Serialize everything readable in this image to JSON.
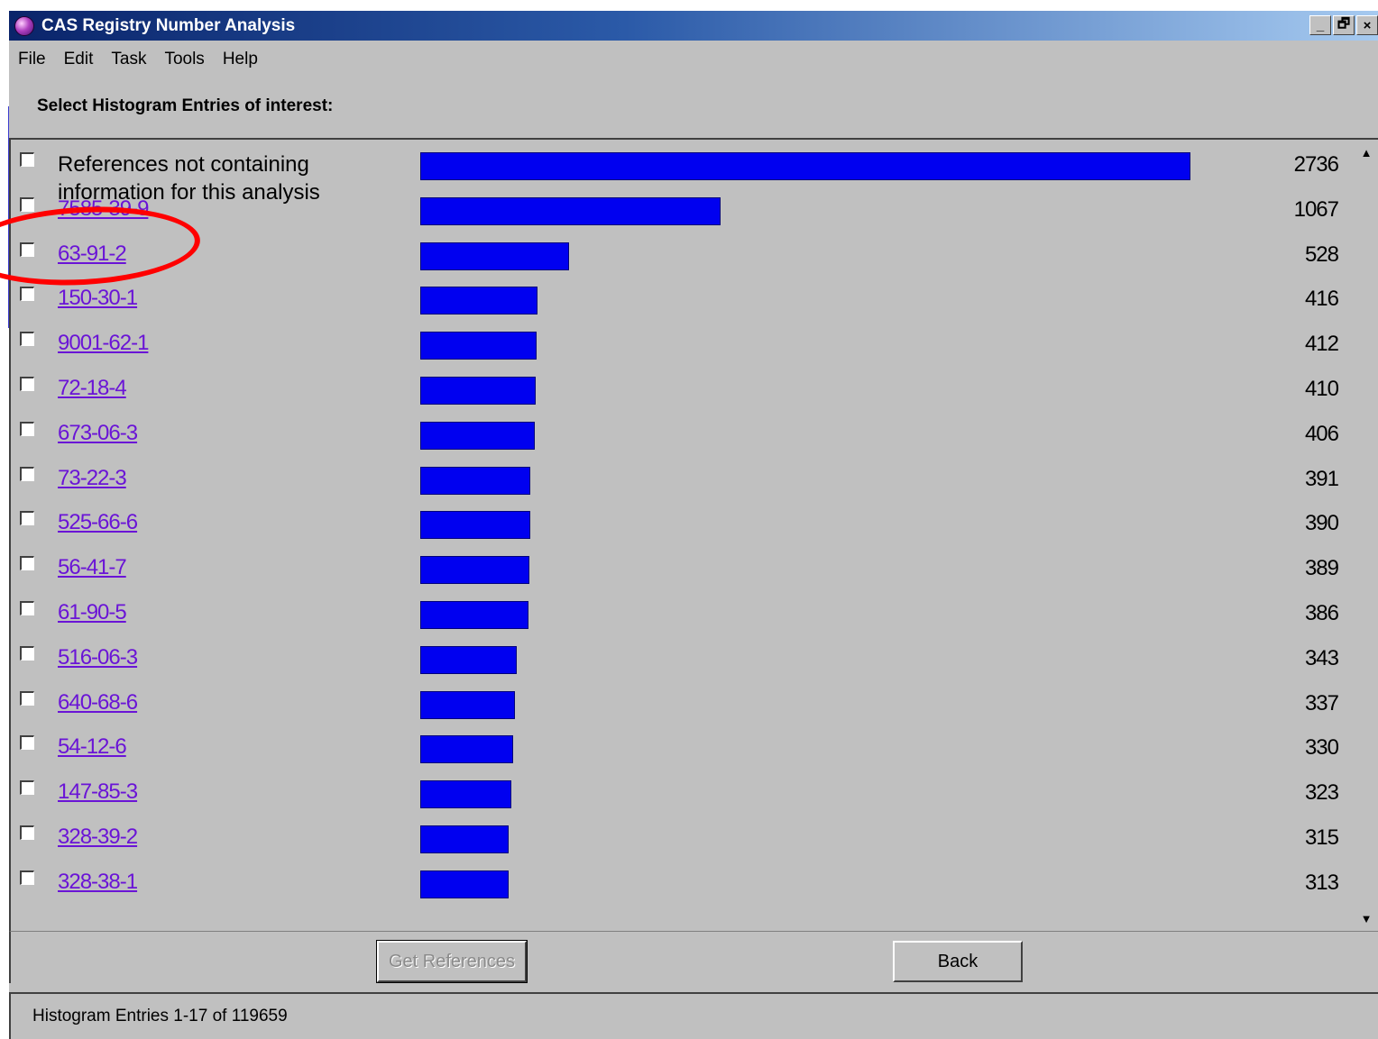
{
  "window": {
    "title": "CAS Registry Number Analysis",
    "controls": {
      "minimize": "_",
      "maximize": "🗗",
      "close": "×"
    }
  },
  "menu": [
    "File",
    "Edit",
    "Task",
    "Tools",
    "Help"
  ],
  "heading": "Select Histogram Entries of interest:",
  "entries": [
    {
      "label": "References not containing information for this analysis",
      "count": "2736",
      "value": 2736,
      "link": false
    },
    {
      "label": "7585-39-9",
      "count": "1067",
      "value": 1067,
      "link": true
    },
    {
      "label": "63-91-2",
      "count": "528",
      "value": 528,
      "link": true
    },
    {
      "label": "150-30-1",
      "count": "416",
      "value": 416,
      "link": true
    },
    {
      "label": "9001-62-1",
      "count": "412",
      "value": 412,
      "link": true
    },
    {
      "label": "72-18-4",
      "count": "410",
      "value": 410,
      "link": true
    },
    {
      "label": "673-06-3",
      "count": "406",
      "value": 406,
      "link": true
    },
    {
      "label": "73-22-3",
      "count": "391",
      "value": 391,
      "link": true
    },
    {
      "label": "525-66-6",
      "count": "390",
      "value": 390,
      "link": true
    },
    {
      "label": "56-41-7",
      "count": "389",
      "value": 389,
      "link": true
    },
    {
      "label": "61-90-5",
      "count": "386",
      "value": 386,
      "link": true
    },
    {
      "label": "516-06-3",
      "count": "343",
      "value": 343,
      "link": true
    },
    {
      "label": "640-68-6",
      "count": "337",
      "value": 337,
      "link": true
    },
    {
      "label": "54-12-6",
      "count": "330",
      "value": 330,
      "link": true
    },
    {
      "label": "147-85-3",
      "count": "323",
      "value": 323,
      "link": true
    },
    {
      "label": "328-39-2",
      "count": "315",
      "value": 315,
      "link": true
    },
    {
      "label": "328-38-1",
      "count": "313",
      "value": 313,
      "link": true
    }
  ],
  "buttons": {
    "get_references": "Get References",
    "back": "Back"
  },
  "status": "Histogram Entries 1-17 of 119659",
  "colors": {
    "bar": "#0000f0",
    "link": "#6a14d6",
    "highlight_annotation": "#ff0000"
  }
}
